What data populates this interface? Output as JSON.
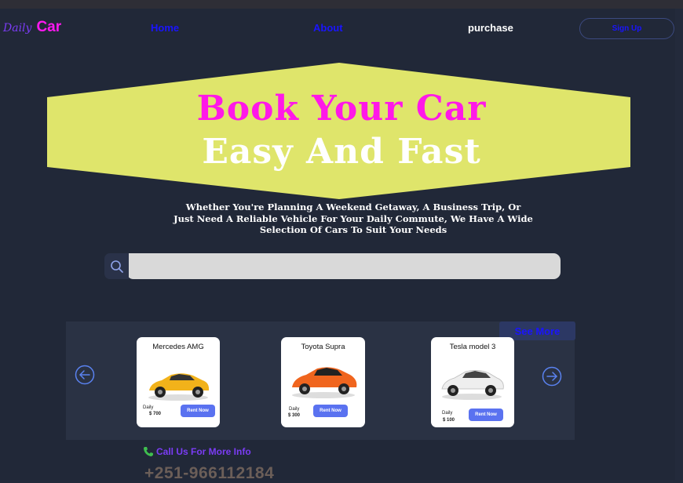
{
  "brand": {
    "script": "Daily",
    "main": "Car"
  },
  "nav": {
    "home": "Home",
    "about": "About",
    "purchase": "purchase",
    "signup": "Sign Up"
  },
  "hero": {
    "title_line1": "Book Your Car",
    "title_line2": "Easy And Fast",
    "subtitle_line1": "Whether You're Planning A Weekend Getaway, A Business Trip, Or",
    "subtitle_line2": "Just Need A Reliable Vehicle For Your Daily Commute, We Have A Wide",
    "subtitle_line3": "Selection Of Cars To Suit Your Needs"
  },
  "search": {
    "value": "",
    "placeholder": "",
    "icon": "search-icon"
  },
  "carousel": {
    "see_more": "See More",
    "prev_icon": "arrow-left-circle-icon",
    "next_icon": "arrow-right-circle-icon",
    "cars": [
      {
        "name": "Mercedes AMG",
        "period": "Daily",
        "price": "$ 700",
        "action": "Rent Now",
        "color": "#f2b21a"
      },
      {
        "name": "Toyota Supra",
        "period": "Daily",
        "price": "$ 300",
        "action": "Rent Now",
        "color": "#f0651e"
      },
      {
        "name": "Tesla model 3",
        "period": "Daily",
        "price": "$ 100",
        "action": "Rent Now",
        "color": "#eeeeee"
      }
    ]
  },
  "contact": {
    "label": "Call Us For More Info",
    "phone": "+251-966112184",
    "icon": "phone-icon"
  },
  "colors": {
    "background": "#212838",
    "accent_magenta": "#ff18e8",
    "accent_blue": "#1a14ff",
    "banner_yellow": "#dfe56b",
    "rent_button": "#5a72f0"
  }
}
